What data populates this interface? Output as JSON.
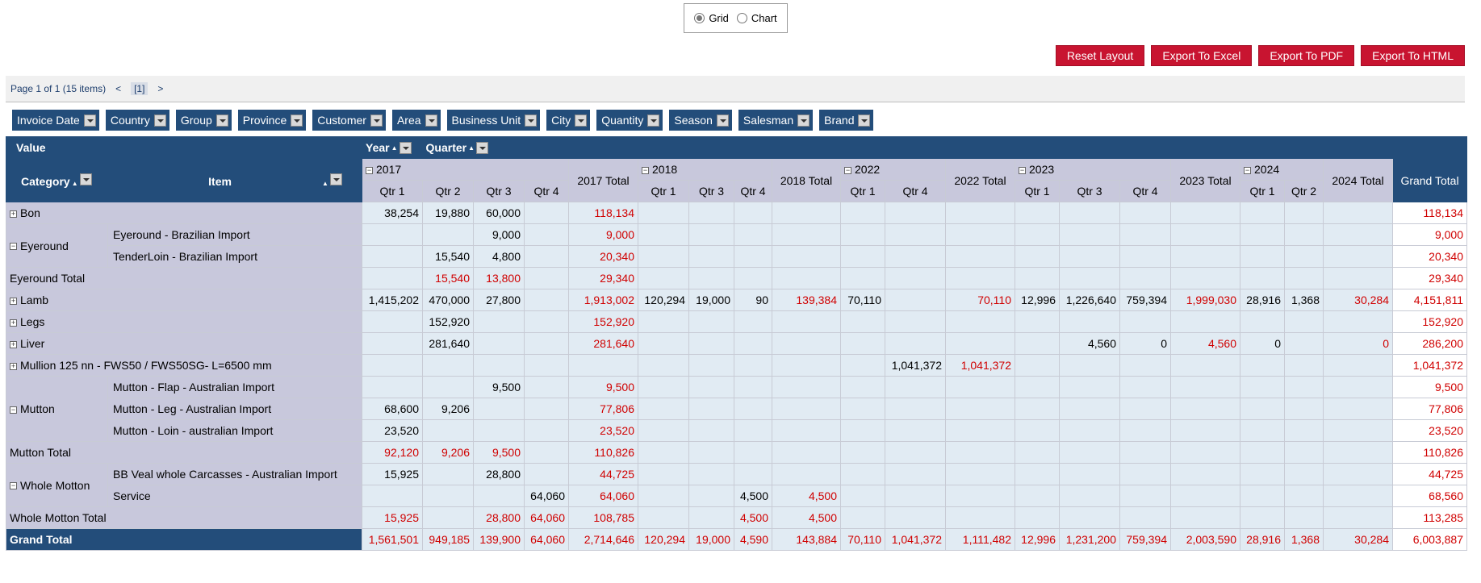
{
  "view_toggle": {
    "grid": "Grid",
    "chart": "Chart",
    "selected": "Grid"
  },
  "buttons": {
    "reset": "Reset Layout",
    "excel": "Export To Excel",
    "pdf": "Export To PDF",
    "html": "Export To HTML"
  },
  "pager": {
    "info": "Page 1 of 1 (15 items)",
    "prev": "<",
    "current": "[1]",
    "next": ">"
  },
  "filter_fields": [
    "Invoice Date",
    "Country",
    "Group",
    "Province",
    "Customer",
    "Area",
    "Business Unit",
    "City",
    "Quantity",
    "Season",
    "Salesman",
    "Brand"
  ],
  "header": {
    "value": "Value",
    "year": "Year",
    "quarter": "Quarter",
    "category": "Category",
    "item": "Item",
    "grand_total": "Grand Total"
  },
  "years": [
    {
      "label": "2017",
      "quarters": [
        "Qtr 1",
        "Qtr 2",
        "Qtr 3",
        "Qtr 4"
      ],
      "total": "2017 Total"
    },
    {
      "label": "2018",
      "quarters": [
        "Qtr 1",
        "Qtr 3",
        "Qtr 4"
      ],
      "total": "2018 Total"
    },
    {
      "label": "2022",
      "quarters": [
        "Qtr 1",
        "Qtr 4"
      ],
      "total": "2022 Total"
    },
    {
      "label": "2023",
      "quarters": [
        "Qtr 1",
        "Qtr 3",
        "Qtr 4"
      ],
      "total": "2023 Total"
    },
    {
      "label": "2024",
      "quarters": [
        "Qtr 1",
        "Qtr 2"
      ],
      "total": "2024 Total"
    }
  ],
  "rows": [
    {
      "type": "cat",
      "category": "Bon",
      "item": "",
      "v": [
        "38,254",
        "19,880",
        "60,000",
        "",
        "118,134",
        "",
        "",
        "",
        "",
        "",
        "",
        "",
        "",
        "",
        "",
        "",
        "",
        "",
        "",
        "118,134"
      ]
    },
    {
      "type": "item",
      "category": "Eyeround",
      "span": 2,
      "item": "Eyeround - Brazilian Import",
      "v": [
        "",
        "",
        "9,000",
        "",
        "9,000",
        "",
        "",
        "",
        "",
        "",
        "",
        "",
        "",
        "",
        "",
        "",
        "",
        "",
        "",
        "9,000"
      ]
    },
    {
      "type": "item",
      "item": "TenderLoin - Brazilian Import",
      "v": [
        "",
        "15,540",
        "4,800",
        "",
        "20,340",
        "",
        "",
        "",
        "",
        "",
        "",
        "",
        "",
        "",
        "",
        "",
        "",
        "",
        "",
        "20,340"
      ]
    },
    {
      "type": "total",
      "category": "Eyeround Total",
      "v": [
        "",
        "15,540",
        "13,800",
        "",
        "29,340",
        "",
        "",
        "",
        "",
        "",
        "",
        "",
        "",
        "",
        "",
        "",
        "",
        "",
        "",
        "29,340"
      ]
    },
    {
      "type": "cat",
      "category": "Lamb",
      "item": "",
      "v": [
        "1,415,202",
        "470,000",
        "27,800",
        "",
        "1,913,002",
        "120,294",
        "19,000",
        "90",
        "139,384",
        "70,110",
        "",
        "70,110",
        "12,996",
        "1,226,640",
        "759,394",
        "1,999,030",
        "28,916",
        "1,368",
        "30,284",
        "4,151,811"
      ]
    },
    {
      "type": "cat",
      "category": "Legs",
      "item": "",
      "v": [
        "",
        "152,920",
        "",
        "",
        "152,920",
        "",
        "",
        "",
        "",
        "",
        "",
        "",
        "",
        "",
        "",
        "",
        "",
        "",
        "",
        "152,920"
      ]
    },
    {
      "type": "cat",
      "category": "Liver",
      "item": "",
      "v": [
        "",
        "281,640",
        "",
        "",
        "281,640",
        "",
        "",
        "",
        "",
        "",
        "",
        "",
        "",
        "4,560",
        "0",
        "4,560",
        "0",
        "",
        "0",
        "286,200"
      ]
    },
    {
      "type": "cat",
      "category": "Mullion 125 nn - FWS50 / FWS50SG- L=6500 mm",
      "item": "",
      "v": [
        "",
        "",
        "",
        "",
        "",
        "",
        "",
        "",
        "",
        "",
        "1,041,372",
        "1,041,372",
        "",
        "",
        "",
        "",
        "",
        "",
        "",
        "1,041,372"
      ]
    },
    {
      "type": "item",
      "category": "Mutton",
      "span": 3,
      "item": "Mutton - Flap - Australian Import",
      "v": [
        "",
        "",
        "9,500",
        "",
        "9,500",
        "",
        "",
        "",
        "",
        "",
        "",
        "",
        "",
        "",
        "",
        "",
        "",
        "",
        "",
        "9,500"
      ]
    },
    {
      "type": "item",
      "item": "Mutton - Leg - Australian Import",
      "v": [
        "68,600",
        "9,206",
        "",
        "",
        "77,806",
        "",
        "",
        "",
        "",
        "",
        "",
        "",
        "",
        "",
        "",
        "",
        "",
        "",
        "",
        "77,806"
      ]
    },
    {
      "type": "item",
      "item": "Mutton - Loin - australian Import",
      "v": [
        "23,520",
        "",
        "",
        "",
        "23,520",
        "",
        "",
        "",
        "",
        "",
        "",
        "",
        "",
        "",
        "",
        "",
        "",
        "",
        "",
        "23,520"
      ]
    },
    {
      "type": "total",
      "category": "Mutton Total",
      "v": [
        "92,120",
        "9,206",
        "9,500",
        "",
        "110,826",
        "",
        "",
        "",
        "",
        "",
        "",
        "",
        "",
        "",
        "",
        "",
        "",
        "",
        "",
        "110,826"
      ]
    },
    {
      "type": "item",
      "category": "Whole Motton",
      "span": 2,
      "item": "BB Veal whole Carcasses - Australian Import",
      "v": [
        "15,925",
        "",
        "28,800",
        "",
        "44,725",
        "",
        "",
        "",
        "",
        "",
        "",
        "",
        "",
        "",
        "",
        "",
        "",
        "",
        "",
        "44,725"
      ]
    },
    {
      "type": "item",
      "item": "Service",
      "v": [
        "",
        "",
        "",
        "64,060",
        "64,060",
        "",
        "",
        "4,500",
        "4,500",
        "",
        "",
        "",
        "",
        "",
        "",
        "",
        "",
        "",
        "",
        "68,560"
      ]
    },
    {
      "type": "total",
      "category": "Whole Motton Total",
      "v": [
        "15,925",
        "",
        "28,800",
        "64,060",
        "108,785",
        "",
        "",
        "4,500",
        "4,500",
        "",
        "",
        "",
        "",
        "",
        "",
        "",
        "",
        "",
        "",
        "113,285"
      ]
    }
  ],
  "grand_total_row": {
    "label": "Grand Total",
    "v": [
      "1,561,501",
      "949,185",
      "139,900",
      "64,060",
      "2,714,646",
      "120,294",
      "19,000",
      "4,590",
      "143,884",
      "70,110",
      "1,041,372",
      "1,111,482",
      "12,996",
      "1,231,200",
      "759,394",
      "2,003,590",
      "28,916",
      "1,368",
      "30,284",
      "6,003,887"
    ]
  }
}
